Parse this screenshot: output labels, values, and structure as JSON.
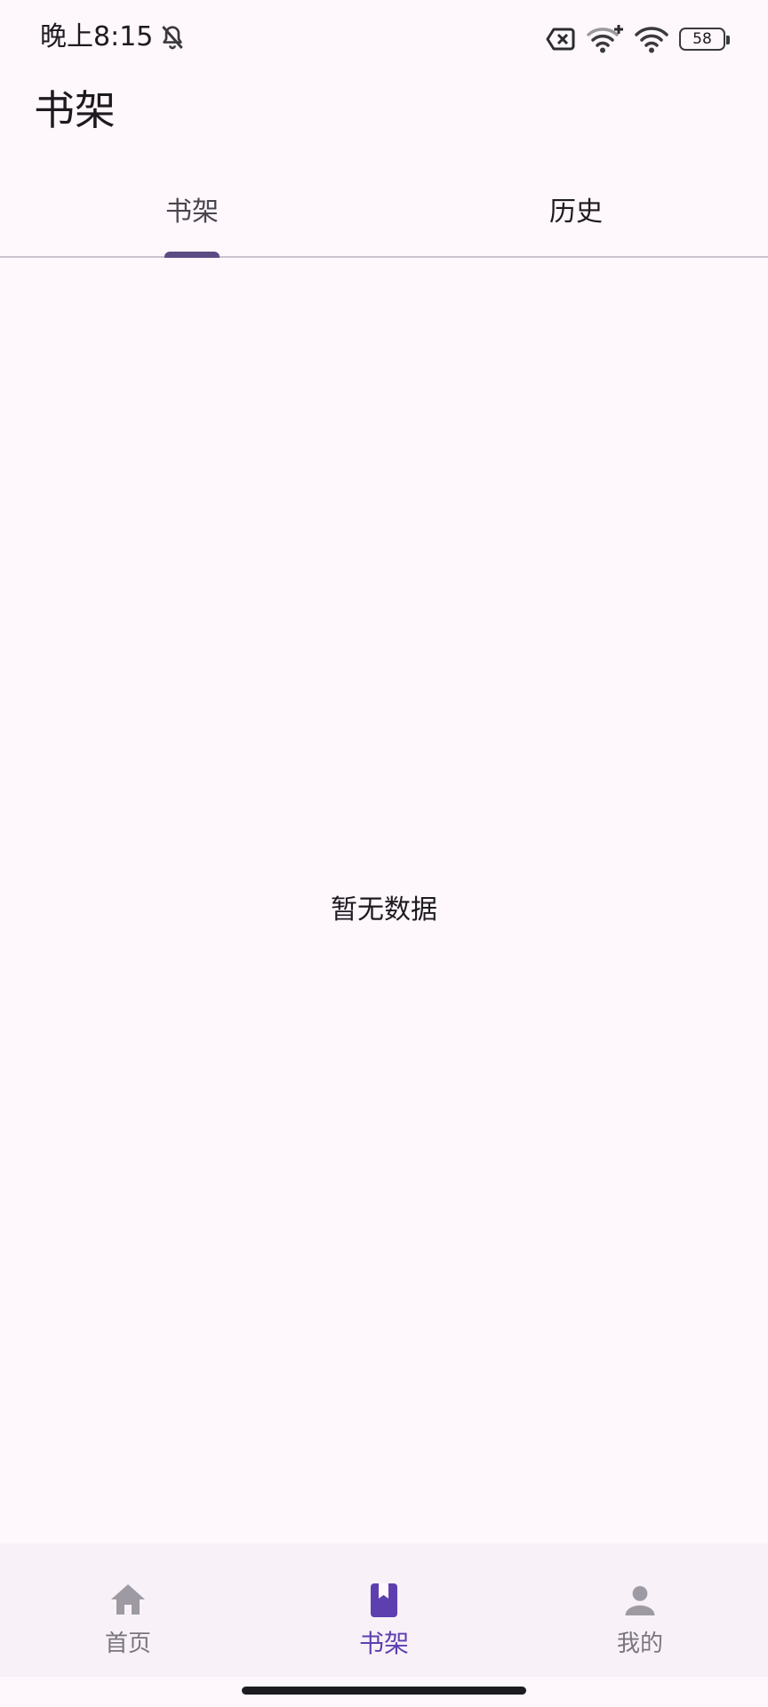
{
  "status_bar": {
    "time": "晚上8:15",
    "battery_level": "58",
    "icons": [
      "bell-off-icon",
      "no-sim-icon",
      "wifi-plus-icon",
      "wifi-icon",
      "battery-icon"
    ]
  },
  "header": {
    "title": "书架"
  },
  "tabs": [
    {
      "label": "书架",
      "selected": true
    },
    {
      "label": "历史",
      "selected": false
    }
  ],
  "content": {
    "empty_message": "暂无数据"
  },
  "bottom_nav": {
    "items": [
      {
        "label": "首页",
        "icon": "home-icon",
        "selected": false
      },
      {
        "label": "书架",
        "icon": "bookmark-book-icon",
        "selected": true
      },
      {
        "label": "我的",
        "icon": "person-icon",
        "selected": false
      }
    ]
  },
  "colors": {
    "background": "#fef7fc",
    "accent": "#5d3fb0",
    "tab_indicator": "#5a4b83",
    "nav_background": "#f8f1f7",
    "inactive_nav": "#9e9aa3"
  }
}
